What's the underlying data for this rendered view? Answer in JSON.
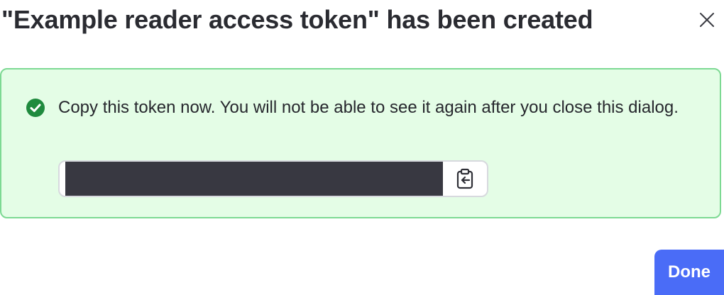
{
  "dialog": {
    "title": "\"Example reader access token\" has been created",
    "close_icon": "close-icon"
  },
  "callout": {
    "status": "success",
    "status_icon": "check-circle-icon",
    "message": "Copy this token now. You will not be able to see it again after you close this dialog.",
    "colors": {
      "background": "#e4fde6",
      "border": "#7dd993",
      "icon": "#1f8a3e"
    }
  },
  "token": {
    "value": "",
    "masked": true,
    "copy_icon": "clipboard-copy-icon"
  },
  "footer": {
    "done_label": "Done",
    "accent_color": "#4a6cf7"
  }
}
